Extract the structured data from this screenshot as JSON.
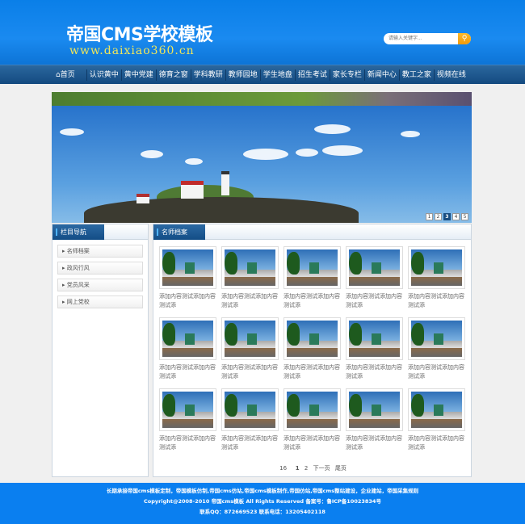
{
  "header": {
    "title": "帝国CMS学校模板",
    "url": "www.daixiao360.cn",
    "search_placeholder": "请输入关键字..."
  },
  "nav": [
    "首页",
    "认识黄中",
    "黄中党建",
    "德育之窗",
    "学科教研",
    "教师园地",
    "学生地盘",
    "招生考试",
    "家长专栏",
    "新闻中心",
    "教工之家",
    "视频在线"
  ],
  "banner": {
    "pages": [
      "1",
      "2",
      "3",
      "4",
      "5"
    ],
    "active": 3
  },
  "sidebar": {
    "title": "栏目导航",
    "items": [
      "名师档案",
      "政风行风",
      "党员风采",
      "网上党校"
    ]
  },
  "main": {
    "title": "名师档案",
    "items": [
      "添加内容测试添加内容测试添",
      "添加内容测试添加内容测试添",
      "添加内容测试添加内容测试添",
      "添加内容测试添加内容测试添",
      "添加内容测试添加内容测试添",
      "添加内容测试添加内容测试添",
      "添加内容测试添加内容测试添",
      "添加内容测试添加内容测试添",
      "添加内容测试添加内容测试添",
      "添加内容测试添加内容测试添",
      "添加内容测试添加内容测试添",
      "添加内容测试添加内容测试添",
      "添加内容测试添加内容测试添",
      "添加内容测试添加内容测试添",
      "添加内容测试添加内容测试添"
    ],
    "pager": {
      "total": "16",
      "pages": [
        "1",
        "2"
      ],
      "next": "下一页",
      "last": "尾页"
    }
  },
  "footer": [
    "长期承接帝国cms模板定制，帝国模板仿制,帝国cms仿站,帝国cms模板制作,帝国仿站,帝国cms整站建设，企业建站，帝国采集规则",
    "Copyright@2008-2010 帝国cms模板  All Rights Reserved 备案号：鲁ICP备10023834号",
    "联系QQ：872669523 联系电话：13205402118"
  ]
}
